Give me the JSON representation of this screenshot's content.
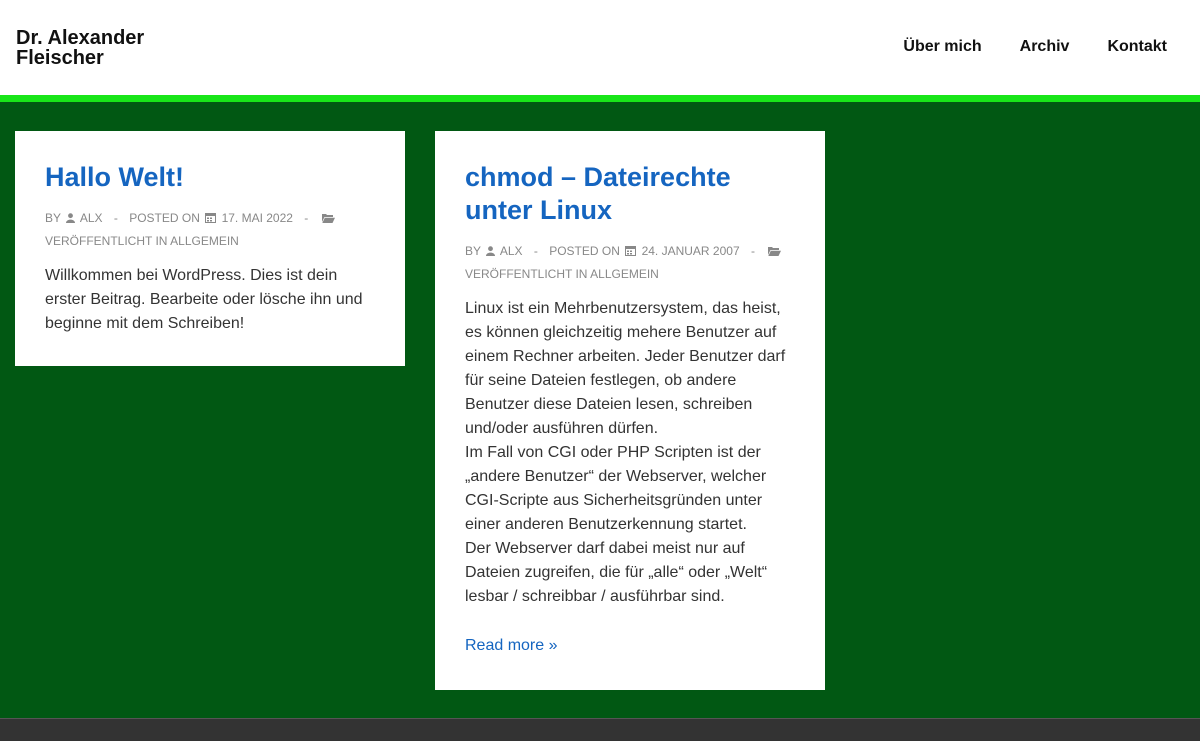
{
  "header": {
    "site_title_line1": "Dr. Alexander",
    "site_title_line2": "Fleischer",
    "nav": [
      "Über mich",
      "Archiv",
      "Kontakt"
    ]
  },
  "colors": {
    "background": "#015813",
    "accent_bar": "#19e619",
    "link": "#1565c0",
    "footer": "#333333"
  },
  "posts": [
    {
      "title": "Hallo Welt!",
      "by": "BY",
      "author": "ALX",
      "posted_on": "POSTED ON",
      "date": "17. MAI 2022",
      "category_prefix": "VERÖFFENTLICHT IN",
      "category": "ALLGEMEIN",
      "paragraphs": [
        "Willkommen bei WordPress. Dies ist dein erster Beitrag. Bearbeite oder lösche ihn und beginne mit dem Schreiben!"
      ]
    },
    {
      "title": "chmod – Dateirechte unter Linux",
      "by": "BY",
      "author": "ALX",
      "posted_on": "POSTED ON",
      "date": "24. JANUAR 2007",
      "category_prefix": "VERÖFFENTLICHT IN",
      "category": "ALLGEMEIN",
      "paragraphs": [
        "Linux ist ein Mehrbenutzersystem, das heist, es können gleichzeitig mehere Benutzer auf einem Rechner arbeiten. Jeder Benutzer darf für seine Dateien festlegen, ob andere Benutzer diese Dateien lesen, schreiben und/oder ausführen dürfen.",
        "Im Fall von CGI oder PHP Scripten ist der „andere Benutzer“ der Webserver, welcher CGI-Scripte aus Sicherheitsgründen unter einer anderen Benutzerkennung startet.",
        "Der Webserver darf dabei meist nur auf Dateien zugreifen, die für „alle“ oder „Welt“ lesbar / schreibbar / ausführbar sind."
      ],
      "read_more": "Read more »"
    }
  ],
  "icons": [
    "user-icon",
    "calendar-icon",
    "folder-icon"
  ]
}
